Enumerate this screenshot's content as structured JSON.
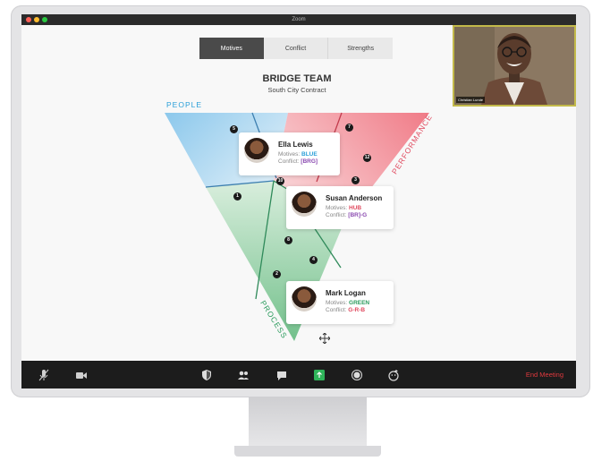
{
  "window": {
    "title": "Zoom"
  },
  "tabs": [
    {
      "label": "Motives",
      "active": true
    },
    {
      "label": "Conflict",
      "active": false
    },
    {
      "label": "Strengths",
      "active": false
    }
  ],
  "team": {
    "title": "BRIDGE TEAM",
    "subtitle": "South City Contract"
  },
  "labels": {
    "people": "PEOPLE",
    "performance": "PERFORMANCE",
    "process": "PROCESS"
  },
  "video": {
    "participant_name": "Christian Lunde"
  },
  "colors": {
    "blue": "#2a9fd8",
    "red": "#e04a5f",
    "green": "#2a9a5c",
    "gray": "#888888",
    "end": "#e0393e"
  },
  "people": [
    {
      "name": "Ella Lewis",
      "motives_label": "Motives:",
      "motives_value": "BLUE",
      "conflict_label": "Conflict:",
      "conflict_value": "[BRG]"
    },
    {
      "name": "Susan Anderson",
      "motives_label": "Motives:",
      "motives_value": "HUB",
      "conflict_label": "Conflict:",
      "conflict_value": "[BR]-G"
    },
    {
      "name": "Mark Logan",
      "motives_label": "Motives:",
      "motives_value": "GREEN",
      "conflict_label": "Conflict:",
      "conflict_value": "G-R-B"
    }
  ],
  "markers": [
    "5",
    "7",
    "12",
    "10",
    "3",
    "1",
    "8",
    "4",
    "2"
  ],
  "toolbar": {
    "end_meeting": "End Meeting",
    "icons": [
      "microphone-icon",
      "video-camera-icon",
      "security-shield-icon",
      "participants-icon",
      "chat-icon",
      "share-screen-icon",
      "record-icon",
      "reactions-icon"
    ]
  }
}
